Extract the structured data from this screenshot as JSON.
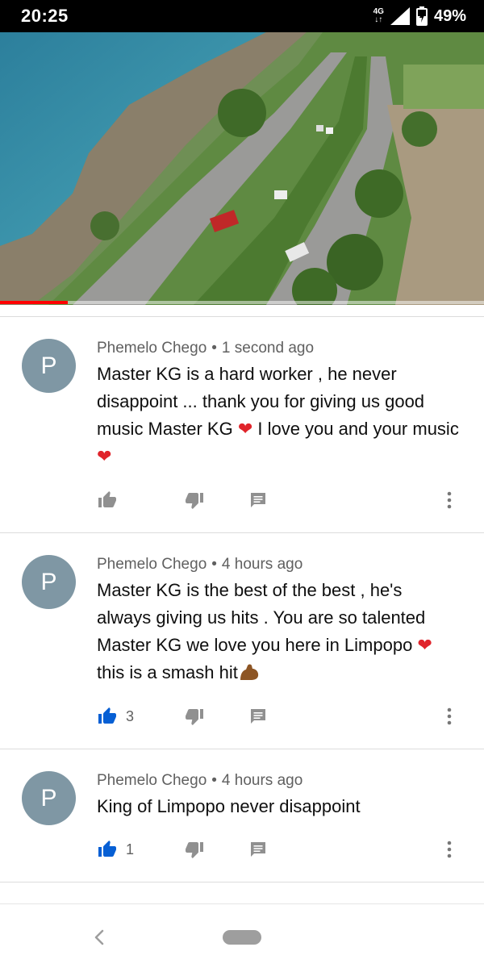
{
  "status_bar": {
    "time": "20:25",
    "network_label": "4G",
    "battery_percent": "49%"
  },
  "video": {
    "progress_fraction": 0.14
  },
  "comments": [
    {
      "avatar_letter": "P",
      "author": "Phemelo Chego",
      "separator": "•",
      "time": "1 second ago",
      "text_parts": [
        "Master KG is a hard worker , he never disappoint ... thank you for giving us good music Master KG ",
        " I love you and your music "
      ],
      "like_count": "",
      "liked": false
    },
    {
      "avatar_letter": "P",
      "author": "Phemelo Chego",
      "separator": "•",
      "time": "4 hours ago",
      "text_parts": [
        "Master KG is the best of the best , he's always giving us hits . You are so talented Master KG we love you here in Limpopo ",
        " this is a smash hit"
      ],
      "like_count": "3",
      "liked": true
    },
    {
      "avatar_letter": "P",
      "author": "Phemelo Chego",
      "separator": "•",
      "time": "4 hours ago",
      "text_parts": [
        "King of Limpopo never disappoint"
      ],
      "like_count": "1",
      "liked": true
    }
  ],
  "icons": {
    "signal": "signal-icon",
    "battery": "battery-charging-icon",
    "like": "thumbs-up-icon",
    "dislike": "thumbs-down-icon",
    "reply": "reply-icon",
    "more": "more-vert-icon",
    "back": "back-icon",
    "home": "home-pill"
  },
  "colors": {
    "liked": "#065fd4",
    "icon_gray": "#909090",
    "avatar": "#7f97a4",
    "heart": "#e0242b",
    "progress": "#ff0000"
  }
}
